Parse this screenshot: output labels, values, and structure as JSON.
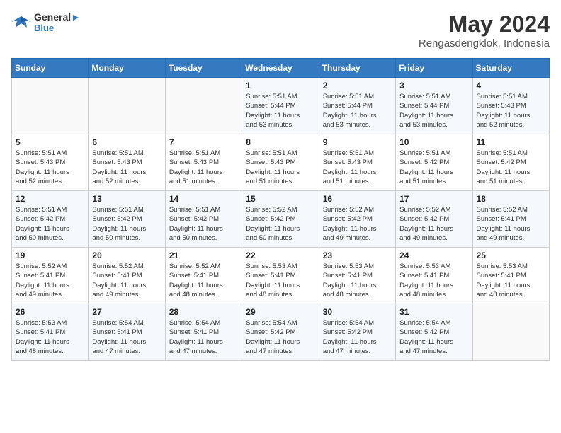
{
  "header": {
    "logo_line1": "General",
    "logo_line2": "Blue",
    "month": "May 2024",
    "location": "Rengasdengklok, Indonesia"
  },
  "weekdays": [
    "Sunday",
    "Monday",
    "Tuesday",
    "Wednesday",
    "Thursday",
    "Friday",
    "Saturday"
  ],
  "weeks": [
    [
      {
        "day": "",
        "info": ""
      },
      {
        "day": "",
        "info": ""
      },
      {
        "day": "",
        "info": ""
      },
      {
        "day": "1",
        "info": "Sunrise: 5:51 AM\nSunset: 5:44 PM\nDaylight: 11 hours\nand 53 minutes."
      },
      {
        "day": "2",
        "info": "Sunrise: 5:51 AM\nSunset: 5:44 PM\nDaylight: 11 hours\nand 53 minutes."
      },
      {
        "day": "3",
        "info": "Sunrise: 5:51 AM\nSunset: 5:44 PM\nDaylight: 11 hours\nand 53 minutes."
      },
      {
        "day": "4",
        "info": "Sunrise: 5:51 AM\nSunset: 5:43 PM\nDaylight: 11 hours\nand 52 minutes."
      }
    ],
    [
      {
        "day": "5",
        "info": "Sunrise: 5:51 AM\nSunset: 5:43 PM\nDaylight: 11 hours\nand 52 minutes."
      },
      {
        "day": "6",
        "info": "Sunrise: 5:51 AM\nSunset: 5:43 PM\nDaylight: 11 hours\nand 52 minutes."
      },
      {
        "day": "7",
        "info": "Sunrise: 5:51 AM\nSunset: 5:43 PM\nDaylight: 11 hours\nand 51 minutes."
      },
      {
        "day": "8",
        "info": "Sunrise: 5:51 AM\nSunset: 5:43 PM\nDaylight: 11 hours\nand 51 minutes."
      },
      {
        "day": "9",
        "info": "Sunrise: 5:51 AM\nSunset: 5:43 PM\nDaylight: 11 hours\nand 51 minutes."
      },
      {
        "day": "10",
        "info": "Sunrise: 5:51 AM\nSunset: 5:42 PM\nDaylight: 11 hours\nand 51 minutes."
      },
      {
        "day": "11",
        "info": "Sunrise: 5:51 AM\nSunset: 5:42 PM\nDaylight: 11 hours\nand 51 minutes."
      }
    ],
    [
      {
        "day": "12",
        "info": "Sunrise: 5:51 AM\nSunset: 5:42 PM\nDaylight: 11 hours\nand 50 minutes."
      },
      {
        "day": "13",
        "info": "Sunrise: 5:51 AM\nSunset: 5:42 PM\nDaylight: 11 hours\nand 50 minutes."
      },
      {
        "day": "14",
        "info": "Sunrise: 5:51 AM\nSunset: 5:42 PM\nDaylight: 11 hours\nand 50 minutes."
      },
      {
        "day": "15",
        "info": "Sunrise: 5:52 AM\nSunset: 5:42 PM\nDaylight: 11 hours\nand 50 minutes."
      },
      {
        "day": "16",
        "info": "Sunrise: 5:52 AM\nSunset: 5:42 PM\nDaylight: 11 hours\nand 49 minutes."
      },
      {
        "day": "17",
        "info": "Sunrise: 5:52 AM\nSunset: 5:42 PM\nDaylight: 11 hours\nand 49 minutes."
      },
      {
        "day": "18",
        "info": "Sunrise: 5:52 AM\nSunset: 5:41 PM\nDaylight: 11 hours\nand 49 minutes."
      }
    ],
    [
      {
        "day": "19",
        "info": "Sunrise: 5:52 AM\nSunset: 5:41 PM\nDaylight: 11 hours\nand 49 minutes."
      },
      {
        "day": "20",
        "info": "Sunrise: 5:52 AM\nSunset: 5:41 PM\nDaylight: 11 hours\nand 49 minutes."
      },
      {
        "day": "21",
        "info": "Sunrise: 5:52 AM\nSunset: 5:41 PM\nDaylight: 11 hours\nand 48 minutes."
      },
      {
        "day": "22",
        "info": "Sunrise: 5:53 AM\nSunset: 5:41 PM\nDaylight: 11 hours\nand 48 minutes."
      },
      {
        "day": "23",
        "info": "Sunrise: 5:53 AM\nSunset: 5:41 PM\nDaylight: 11 hours\nand 48 minutes."
      },
      {
        "day": "24",
        "info": "Sunrise: 5:53 AM\nSunset: 5:41 PM\nDaylight: 11 hours\nand 48 minutes."
      },
      {
        "day": "25",
        "info": "Sunrise: 5:53 AM\nSunset: 5:41 PM\nDaylight: 11 hours\nand 48 minutes."
      }
    ],
    [
      {
        "day": "26",
        "info": "Sunrise: 5:53 AM\nSunset: 5:41 PM\nDaylight: 11 hours\nand 48 minutes."
      },
      {
        "day": "27",
        "info": "Sunrise: 5:54 AM\nSunset: 5:41 PM\nDaylight: 11 hours\nand 47 minutes."
      },
      {
        "day": "28",
        "info": "Sunrise: 5:54 AM\nSunset: 5:41 PM\nDaylight: 11 hours\nand 47 minutes."
      },
      {
        "day": "29",
        "info": "Sunrise: 5:54 AM\nSunset: 5:42 PM\nDaylight: 11 hours\nand 47 minutes."
      },
      {
        "day": "30",
        "info": "Sunrise: 5:54 AM\nSunset: 5:42 PM\nDaylight: 11 hours\nand 47 minutes."
      },
      {
        "day": "31",
        "info": "Sunrise: 5:54 AM\nSunset: 5:42 PM\nDaylight: 11 hours\nand 47 minutes."
      },
      {
        "day": "",
        "info": ""
      }
    ]
  ]
}
